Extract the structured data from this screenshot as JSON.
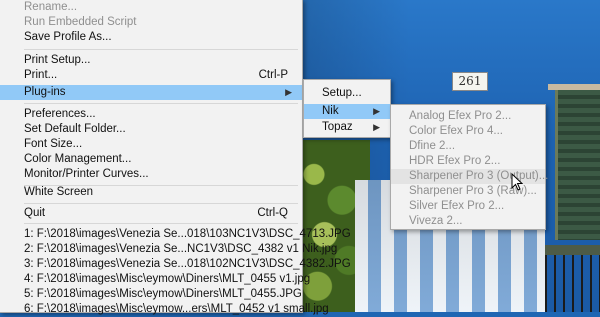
{
  "background": {
    "house_number": "261"
  },
  "file_menu": {
    "items": [
      {
        "label": "Rename...",
        "disabled": false
      },
      {
        "label": "Run Embedded Script",
        "disabled": true
      },
      {
        "label": "Save Profile As...",
        "disabled": false
      },
      {
        "label": "Print Setup...",
        "disabled": false
      },
      {
        "label": "Print...",
        "shortcut": "Ctrl-P",
        "disabled": false
      },
      {
        "label": "Plug-ins",
        "disabled": false,
        "selected": true,
        "has_submenu": true
      },
      {
        "label": "Preferences...",
        "disabled": false
      },
      {
        "label": "Set Default Folder...",
        "disabled": false
      },
      {
        "label": "Font Size...",
        "disabled": false
      },
      {
        "label": "Color Management...",
        "disabled": false
      },
      {
        "label": "Monitor/Printer Curves...",
        "disabled": false
      },
      {
        "label": "White Screen",
        "disabled": false
      },
      {
        "label": "Quit",
        "shortcut": "Ctrl-Q",
        "disabled": false
      }
    ],
    "recent_files": [
      "1: F:\\2018\\images\\Venezia Se...018\\103NC1V3\\DSC_4713.JPG",
      "2: F:\\2018\\images\\Venezia Se...NC1V3\\DSC_4382 v1 Nik.jpg",
      "3: F:\\2018\\images\\Venezia Se...018\\102NC1V3\\DSC_4382.JPG",
      "4: F:\\2018\\images\\Misc\\eymow\\Diners\\MLT_0455 v1.jpg",
      "5: F:\\2018\\images\\Misc\\eymow\\Diners\\MLT_0455.JPG",
      "6: F:\\2018\\images\\Misc\\eymow...ers\\MLT_0452 v1 small.jpg"
    ]
  },
  "plugins_menu": {
    "items": [
      {
        "label": "Setup...",
        "has_submenu": false,
        "selected": false
      },
      {
        "label": "Nik",
        "has_submenu": true,
        "selected": true
      },
      {
        "label": "Topaz",
        "has_submenu": true,
        "selected": false
      }
    ]
  },
  "nik_menu": {
    "items": [
      {
        "label": "Analog Efex Pro 2...",
        "selected": false
      },
      {
        "label": "Color Efex Pro 4...",
        "selected": false
      },
      {
        "label": "Dfine 2...",
        "selected": false
      },
      {
        "label": "HDR Efex Pro 2...",
        "selected": false
      },
      {
        "label": "Sharpener Pro 3 (Output)...",
        "selected": true
      },
      {
        "label": "Sharpener Pro 3 (Raw)...",
        "selected": false
      },
      {
        "label": "Silver Efex Pro 2...",
        "selected": false
      },
      {
        "label": "Viveza 2...",
        "selected": false
      }
    ]
  },
  "colors": {
    "menu_bg": "#f2f2f2",
    "highlight": "#91c9f7",
    "disabled_text": "#8f8f8f"
  }
}
